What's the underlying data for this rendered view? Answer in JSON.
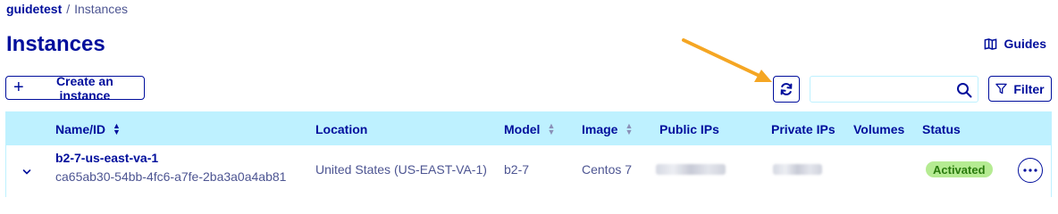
{
  "breadcrumb": {
    "project": "guidetest",
    "separator": "/",
    "current": "Instances"
  },
  "page": {
    "title": "Instances"
  },
  "guides": {
    "label": "Guides",
    "icon": "book-icon"
  },
  "toolbar": {
    "create_label": "Create an instance",
    "create_icon": "plus-icon",
    "refresh_icon": "refresh-icon",
    "search_value": "",
    "search_icon": "search-icon",
    "filter_label": "Filter",
    "filter_icon": "filter-icon"
  },
  "annotation": {
    "arrow_color": "#f5a623",
    "icon": "arrow-icon"
  },
  "table": {
    "columns": [
      "Name/ID",
      "Location",
      "Model",
      "Image",
      "Public IPs",
      "Private IPs",
      "Volumes",
      "Status"
    ],
    "sortable": [
      "Name/ID",
      "Model",
      "Image"
    ],
    "rows": [
      {
        "name": "b2-7-us-east-va-1",
        "id": "ca65ab30-54bb-4fc6-a7fe-2ba3a0a4ab81",
        "location": "United States (US-EAST-VA-1)",
        "model": "b2-7",
        "image": "Centos 7",
        "public_ip": "",
        "private_ip": "",
        "volumes": "",
        "status": "Activated"
      }
    ]
  },
  "colors": {
    "primary": "#000e9c",
    "header_bg": "#bef1ff",
    "badge_bg": "#b5eb92",
    "badge_text": "#2a7b0e"
  }
}
